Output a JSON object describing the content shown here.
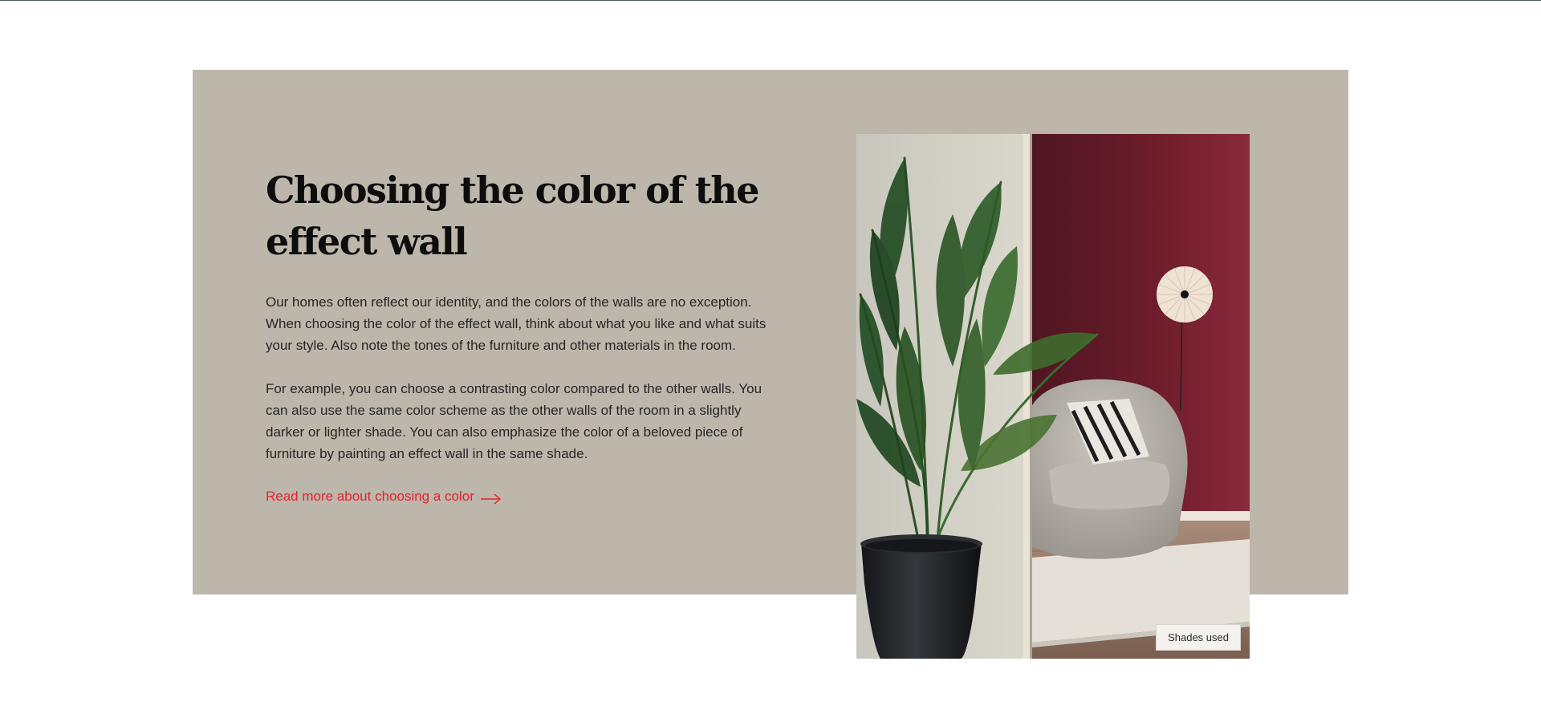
{
  "article": {
    "title": "Choosing the color of the effect wall",
    "paragraphs": [
      "Our homes often reflect our identity, and the colors of the walls are no exception. When choosing the color of the effect wall, think about what you like and what suits your style. Also note the tones of the furniture and other materials in the room.",
      "For example, you can choose a contrasting color compared to the other walls. You can also use the same color scheme as the other walls of the room in a slightly darker or lighter shade. You can also emphasize the color of a beloved piece of furniture by painting an effect wall in the same shade."
    ],
    "read_more_label": "Read more about choosing a color",
    "read_more_icon": "arrow-right-icon"
  },
  "photo": {
    "shades_button_label": "Shades used"
  },
  "colors": {
    "panel_background": "#bdb6aa",
    "accent_link": "#e3242b",
    "effect_wall": "#7a1f30"
  }
}
